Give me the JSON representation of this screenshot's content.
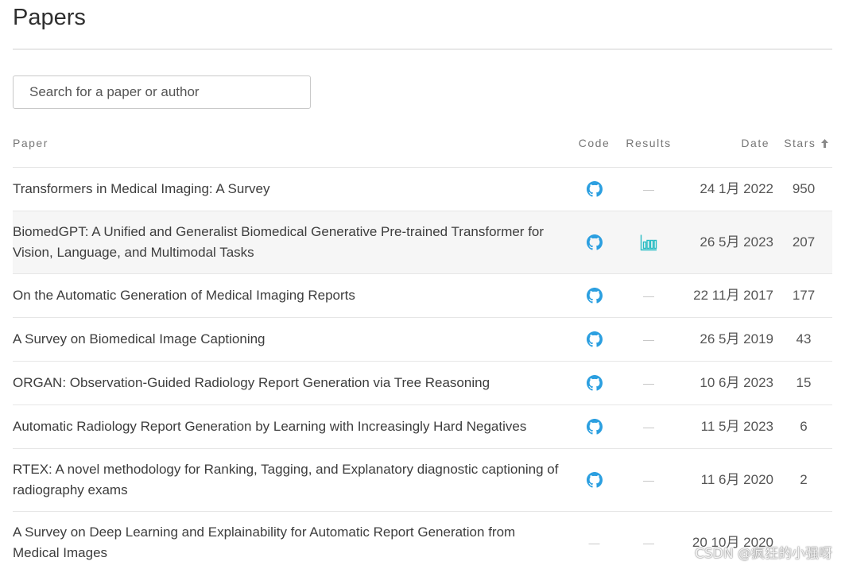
{
  "page": {
    "title": "Papers"
  },
  "search": {
    "placeholder": "Search for a paper or author"
  },
  "table": {
    "columns": {
      "paper": "Paper",
      "code": "Code",
      "results": "Results",
      "date": "Date",
      "stars": "Stars"
    },
    "sort_icon": "sort-arrow-up-icon",
    "rows": [
      {
        "title": "Transformers in Medical Imaging: A Survey",
        "code": {
          "icon": "github-icon"
        },
        "results": {
          "text": "—"
        },
        "date": "24 1月 2022",
        "stars": "950"
      },
      {
        "title": "BiomedGPT: A Unified and Generalist Biomedical Generative Pre-trained Transformer for Vision, Language, and Multimodal Tasks",
        "code": {
          "icon": "github-icon"
        },
        "results": {
          "icon": "bar-chart-icon"
        },
        "date": "26 5月 2023",
        "stars": "207",
        "highlighted": true
      },
      {
        "title": "On the Automatic Generation of Medical Imaging Reports",
        "code": {
          "icon": "github-icon"
        },
        "results": {
          "text": "—"
        },
        "date": "22 11月 2017",
        "stars": "177"
      },
      {
        "title": "A Survey on Biomedical Image Captioning",
        "code": {
          "icon": "github-icon"
        },
        "results": {
          "text": "—"
        },
        "date": "26 5月 2019",
        "stars": "43"
      },
      {
        "title": "ORGAN: Observation-Guided Radiology Report Generation via Tree Reasoning",
        "code": {
          "icon": "github-icon"
        },
        "results": {
          "text": "—"
        },
        "date": "10 6月 2023",
        "stars": "15"
      },
      {
        "title": "Automatic Radiology Report Generation by Learning with Increasingly Hard Negatives",
        "code": {
          "icon": "github-icon"
        },
        "results": {
          "text": "—"
        },
        "date": "11 5月 2023",
        "stars": "6"
      },
      {
        "title": "RTEX: A novel methodology for Ranking, Tagging, and Explanatory diagnostic captioning of radiography exams",
        "code": {
          "icon": "github-icon"
        },
        "results": {
          "text": "—"
        },
        "date": "11 6月 2020",
        "stars": "2"
      },
      {
        "title": "A Survey on Deep Learning and Explainability for Automatic Report Generation from Medical Images",
        "code": {
          "text": "—"
        },
        "results": {
          "text": "—"
        },
        "date": "20 10月 2020"
      }
    ]
  },
  "colors": {
    "github_icon": "#2b9fe0",
    "results_icon": "#26bcc3",
    "dash": "#c4c4c4",
    "highlight_row": "#f6f6f6",
    "sort_arrow": "#8a8a8a"
  },
  "watermark": {
    "text": "CSDN @疯狂的小强呀"
  }
}
